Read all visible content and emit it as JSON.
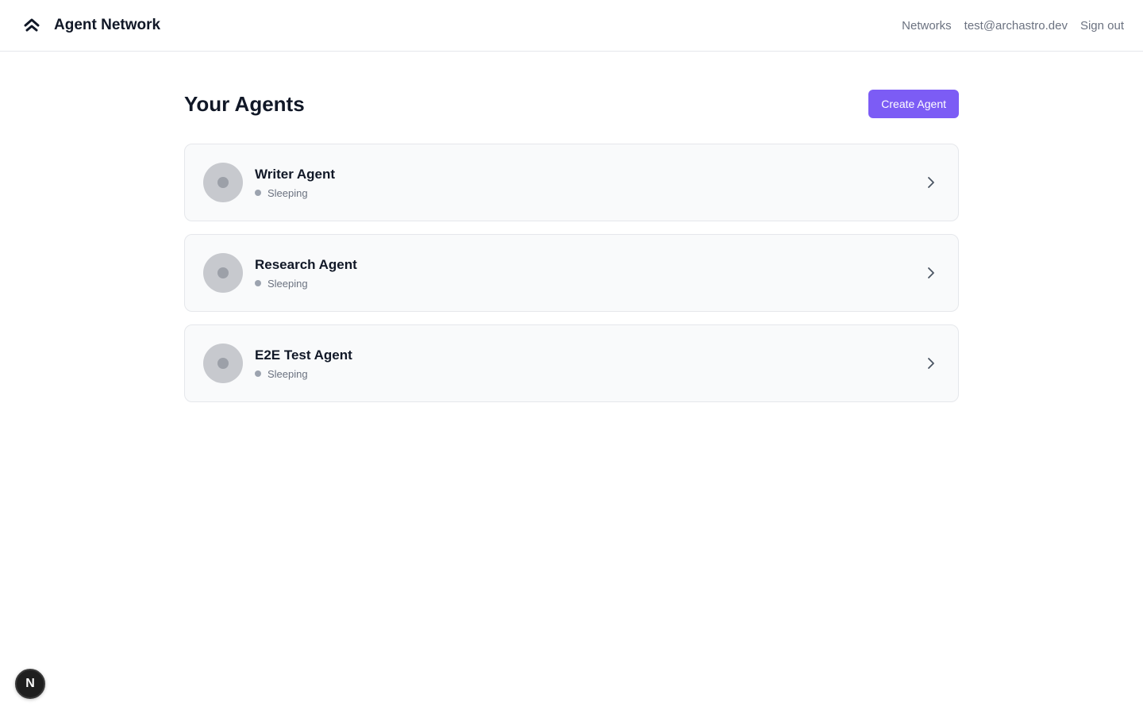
{
  "header": {
    "brand_icon": "double-chevron-up-icon",
    "title": "Agent Network",
    "nav": {
      "networks": "Networks",
      "user_email": "test@archastro.dev",
      "sign_out": "Sign out"
    }
  },
  "main": {
    "title": "Your Agents",
    "create_button": "Create Agent",
    "agents": [
      {
        "name": "Writer Agent",
        "status": "Sleeping"
      },
      {
        "name": "Research Agent",
        "status": "Sleeping"
      },
      {
        "name": "E2E Test Agent",
        "status": "Sleeping"
      }
    ]
  },
  "dev_badge": {
    "label": "N",
    "icon": "nextjs-icon"
  },
  "colors": {
    "accent": "#7c5cf5",
    "border": "#e5e7eb",
    "card_bg": "#f9fafb",
    "muted_text": "#6b7280",
    "status_sleeping": "#9ca3af"
  }
}
